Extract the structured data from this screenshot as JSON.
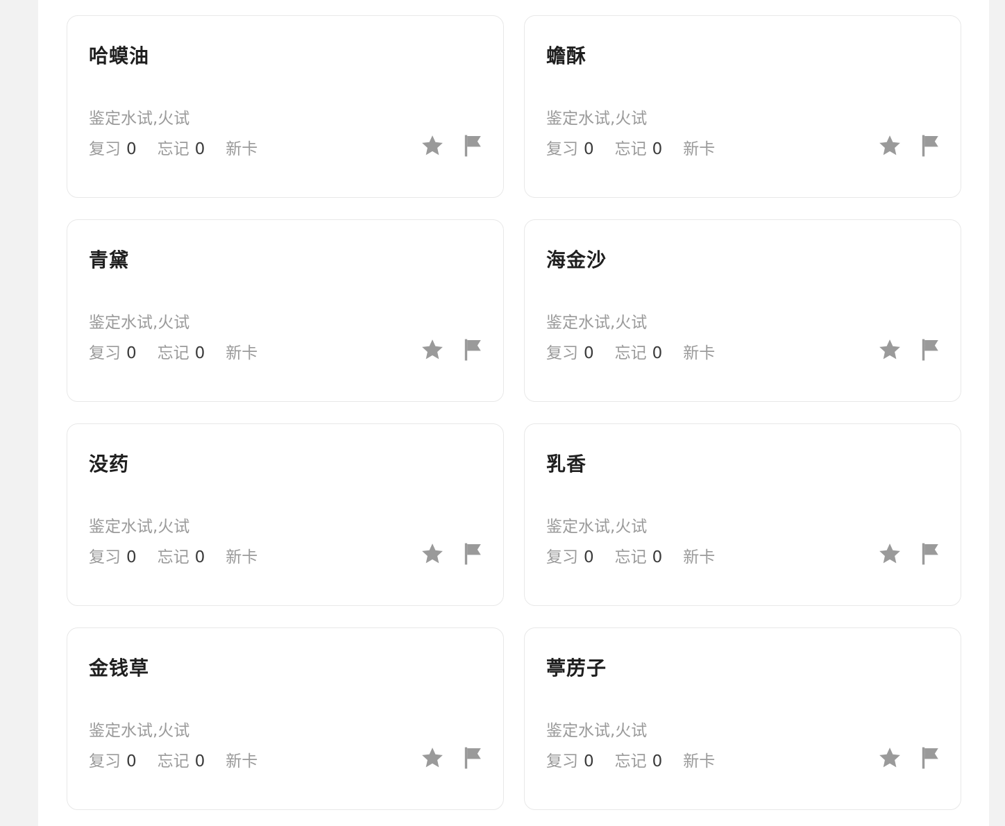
{
  "cards": [
    {
      "title": "哈蟆油",
      "tags": "鉴定水试,火试",
      "review_label": "复习",
      "review_count": "0",
      "forget_label": "忘记",
      "forget_count": "0",
      "status": "新卡"
    },
    {
      "title": "蟾酥",
      "tags": "鉴定水试,火试",
      "review_label": "复习",
      "review_count": "0",
      "forget_label": "忘记",
      "forget_count": "0",
      "status": "新卡"
    },
    {
      "title": "青黛",
      "tags": "鉴定水试,火试",
      "review_label": "复习",
      "review_count": "0",
      "forget_label": "忘记",
      "forget_count": "0",
      "status": "新卡"
    },
    {
      "title": "海金沙",
      "tags": "鉴定水试,火试",
      "review_label": "复习",
      "review_count": "0",
      "forget_label": "忘记",
      "forget_count": "0",
      "status": "新卡"
    },
    {
      "title": "没药",
      "tags": "鉴定水试,火试",
      "review_label": "复习",
      "review_count": "0",
      "forget_label": "忘记",
      "forget_count": "0",
      "status": "新卡"
    },
    {
      "title": "乳香",
      "tags": "鉴定水试,火试",
      "review_label": "复习",
      "review_count": "0",
      "forget_label": "忘记",
      "forget_count": "0",
      "status": "新卡"
    },
    {
      "title": "金钱草",
      "tags": "鉴定水试,火试",
      "review_label": "复习",
      "review_count": "0",
      "forget_label": "忘记",
      "forget_count": "0",
      "status": "新卡"
    },
    {
      "title": "葶苈子",
      "tags": "鉴定水试,火试",
      "review_label": "复习",
      "review_count": "0",
      "forget_label": "忘记",
      "forget_count": "0",
      "status": "新卡"
    }
  ],
  "icons": {
    "star": "star-icon",
    "flag": "flag-icon"
  },
  "colors": {
    "icon": "#9a9a9a",
    "title": "#1f1f1f",
    "muted": "#9a9a9a",
    "number": "#3a3a3a"
  }
}
